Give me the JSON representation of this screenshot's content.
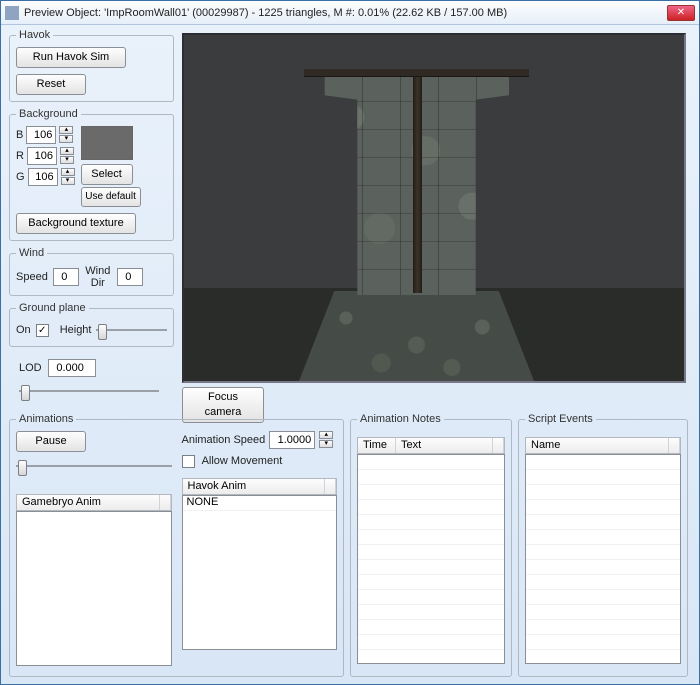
{
  "window": {
    "title": "Preview Object: 'ImpRoomWall01' (00029987) - 1225 triangles, M #: 0.01% (22.62 KB / 157.00 MB)"
  },
  "havok": {
    "legend": "Havok",
    "run": "Run Havok Sim",
    "reset": "Reset"
  },
  "background": {
    "legend": "Background",
    "b_label": "B",
    "b": "106",
    "r_label": "R",
    "r": "106",
    "g_label": "G",
    "g": "106",
    "select": "Select",
    "use_default": "Use default",
    "texture_btn": "Background texture"
  },
  "wind": {
    "legend": "Wind",
    "speed_label": "Speed",
    "speed": "0",
    "dir_label": "Wind Dir",
    "dir": "0"
  },
  "ground": {
    "legend": "Ground plane",
    "on_label": "On",
    "on_checked": "✓",
    "height_label": "Height"
  },
  "lod": {
    "label": "LOD",
    "value": "0.000"
  },
  "focus_camera": "Focus camera",
  "animations": {
    "legend": "Animations",
    "pause": "Pause",
    "speed_label": "Animation Speed",
    "speed": "1.0000",
    "allow_movement": "Allow Movement",
    "gamebryo_col": "Gamebryo Anim",
    "havok_col": "Havok Anim",
    "havok_none": "NONE"
  },
  "animnotes": {
    "legend": "Animation Notes",
    "col_time": "Time",
    "col_text": "Text"
  },
  "scriptev": {
    "legend": "Script Events",
    "col_name": "Name"
  }
}
